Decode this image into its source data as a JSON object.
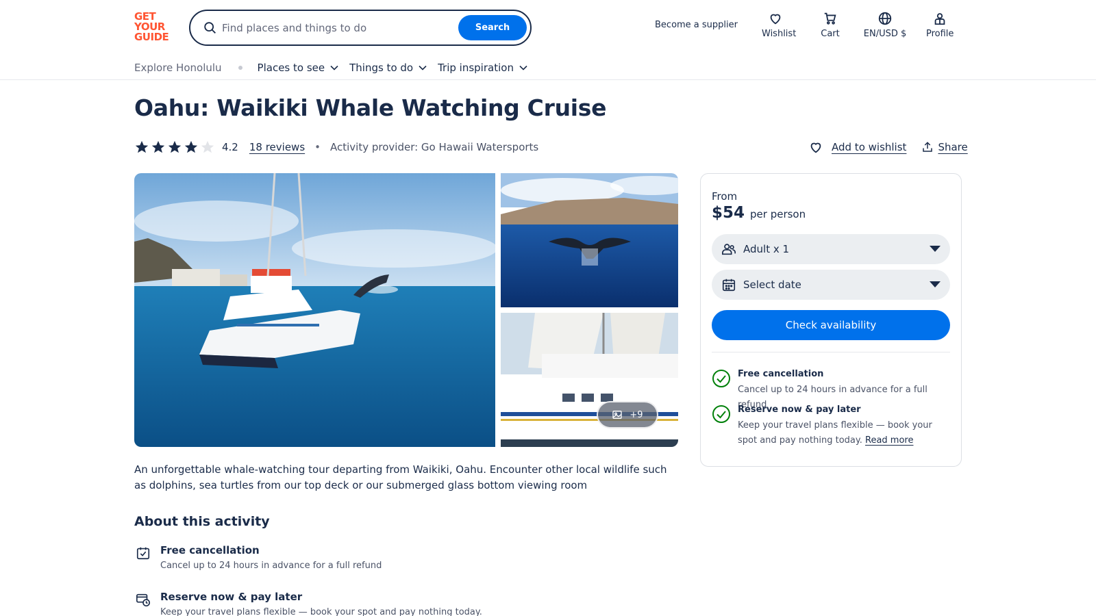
{
  "header": {
    "logo_lines": [
      "GET",
      "YOUR",
      "GUIDE"
    ],
    "search_placeholder": "Find places and things to do",
    "search_button": "Search",
    "supplier_link": "Become a supplier",
    "nav": [
      {
        "label": "Wishlist",
        "icon": "heart-icon"
      },
      {
        "label": "Cart",
        "icon": "cart-icon"
      },
      {
        "label": "EN/USD $",
        "icon": "globe-icon"
      },
      {
        "label": "Profile",
        "icon": "profile-icon"
      }
    ]
  },
  "subnav": {
    "explore": "Explore Honolulu",
    "items": [
      "Places to see",
      "Things to do",
      "Trip inspiration"
    ]
  },
  "activity": {
    "title": "Oahu: Waikiki Whale Watching Cruise",
    "rating": 4.2,
    "rating_label": "4.2",
    "reviews": "18 reviews",
    "provider": "Activity provider: Go Hawaii Watersports",
    "add_to_wishlist": "Add to wishlist",
    "share": "Share",
    "gallery_more": "+9",
    "description": "An unforgettable whale-watching tour departing from Waikiki, Oahu. Encounter other local wildlife such as dolphins, sea turtles from our top deck or our submerged glass bottom viewing room"
  },
  "about": {
    "title": "About this activity",
    "items": [
      {
        "title": "Free cancellation",
        "text": "Cancel up to 24 hours in advance for a full refund",
        "icon": "calendar-check-icon"
      },
      {
        "title": "Reserve now & pay later",
        "text": "Keep your travel plans flexible — book your spot and pay nothing today.",
        "icon": "card-clock-icon"
      }
    ]
  },
  "booking": {
    "from_label": "From",
    "price": "$54",
    "per_person": "per person",
    "participants": "Adult x 1",
    "date_placeholder": "Select date",
    "check_button": "Check availability",
    "perks": [
      {
        "title": "Free cancellation",
        "text": "Cancel up to 24 hours in advance for a full refund"
      },
      {
        "title": "Reserve now & pay later",
        "text": "Keep your travel plans flexible — book your spot and pay nothing today.",
        "link": "Read more"
      }
    ]
  },
  "colors": {
    "brand": "#ff5533",
    "primary_blue": "#0071eb",
    "text_navy": "#1a2b49",
    "success_green": "#008009"
  }
}
